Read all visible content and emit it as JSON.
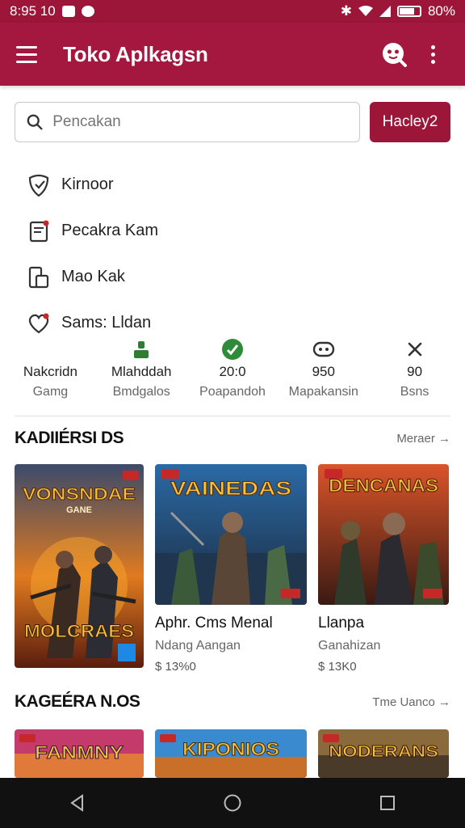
{
  "status_bar": {
    "time": "8:95 10",
    "battery": "80%"
  },
  "app_bar": {
    "title": "Toko Aplkagsn"
  },
  "search": {
    "placeholder": "Pencakan",
    "button_label": "Hacley2"
  },
  "menu": [
    {
      "label": "Kirnoor",
      "icon": "shield-edit-icon"
    },
    {
      "label": "Pecakra Kam",
      "icon": "document-icon"
    },
    {
      "label": "Mao Kak",
      "icon": "device-icon"
    },
    {
      "label": "Sams: Lldan",
      "icon": "heart-icon"
    }
  ],
  "stats": [
    {
      "value": "Nakcridn",
      "label": "Gamg",
      "icon": "none",
      "color": "#222222"
    },
    {
      "value": "Mlahddah",
      "label": "Bmdgalos",
      "icon": "person-icon",
      "color": "#2e7d32"
    },
    {
      "value": "20:0",
      "label": "Poapandoh",
      "icon": "check-badge-icon",
      "color": "#2e8b3a"
    },
    {
      "value": "950",
      "label": "Mapakansin",
      "icon": "gamepad-icon",
      "color": "#333333"
    },
    {
      "value": "90",
      "label": "Bsns",
      "icon": "close-icon",
      "color": "#333333"
    }
  ],
  "section1": {
    "title": "KADIIÉRSI DS",
    "more": "Meraer →",
    "cards": [
      {
        "art_text": "VONSNDAE",
        "art_sub": "GANE",
        "art_bottom": "MOLCRAES",
        "title": "",
        "subtitle": "",
        "price": ""
      },
      {
        "art_text": "VAINEDAS",
        "art_sub": "",
        "art_bottom": "",
        "title": "Aphr. Cms Menal",
        "subtitle": "Ndang Aangan",
        "price": "$ 13%0"
      },
      {
        "art_text": "DENCANAS",
        "art_sub": "",
        "art_bottom": "",
        "title": "Llanpa",
        "subtitle": "Ganahizan",
        "price": "$ 13K0"
      }
    ]
  },
  "section2": {
    "title": "KAGEÉRA N.OS",
    "more": "Tme Uanco →",
    "cards": [
      {
        "art_text": "FANMNY"
      },
      {
        "art_text": "KIPONIOS"
      },
      {
        "art_text": "NODERANS"
      }
    ]
  },
  "colors": {
    "primary": "#a4173e",
    "status": "#9b1638",
    "accent_green": "#2e7d32"
  }
}
